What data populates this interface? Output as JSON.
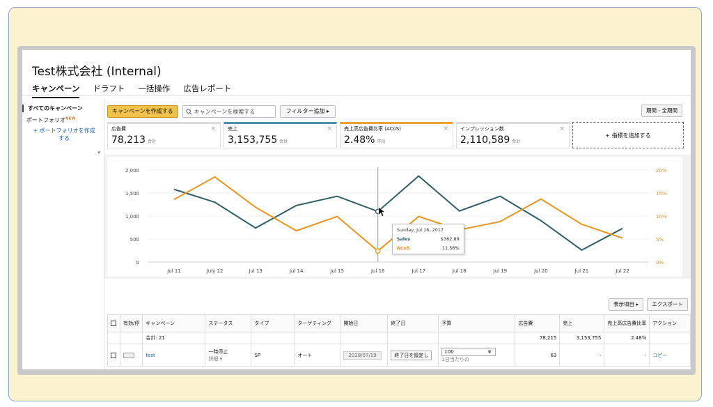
{
  "company": "Test株式会社 (Internal)",
  "tabs": [
    "キャンペーン",
    "ドラフト",
    "一括操作",
    "広告レポート"
  ],
  "sidebar": {
    "all_campaigns": "すべてのキャンペーン",
    "portfolio": "ポートフォリオ",
    "portfolio_badge": "NEW",
    "create_portfolio": "+ ポートフォリオを作成する"
  },
  "toolbar": {
    "create_campaign": "キャンペーンを作成する",
    "search_placeholder": "キャンペーンを検索する",
    "add_filter": "フィルター追加",
    "period": "期間 - 全期間"
  },
  "metrics": [
    {
      "label": "広告費",
      "value": "78,213",
      "suffix": "合計"
    },
    {
      "label": "売上",
      "value": "3,153,755",
      "suffix": "合計"
    },
    {
      "label": "売上高広告費比率 (ACoS)",
      "value": "2.48%",
      "suffix": "平均"
    },
    {
      "label": "インプレッション数",
      "value": "2,110,589",
      "suffix": "合計"
    }
  ],
  "add_metric": "+ 指標を追加する",
  "chart_data": {
    "type": "line",
    "categories": [
      "Jul 11",
      "July 12",
      "Jul 13",
      "Jul 14",
      "Jul 15",
      "Jul 16",
      "Jul 17",
      "Jul 18",
      "Jul 19",
      "Jul 20",
      "Jul 21",
      "Jul 22"
    ],
    "series": [
      {
        "name": "Sales",
        "axis": "left",
        "color": "#2e5e63",
        "values": [
          1580,
          1300,
          740,
          1230,
          1430,
          1100,
          1870,
          1110,
          1430,
          900,
          260,
          730
        ]
      },
      {
        "name": "ACoS",
        "axis": "right",
        "color": "#e69422",
        "values": [
          13.6,
          18.5,
          11.9,
          6.8,
          9.9,
          2.4,
          9.9,
          7.0,
          8.8,
          13.7,
          8.2,
          5.2
        ]
      }
    ],
    "yleft_ticks": [
      "2,000",
      "1,500",
      "1,000",
      "500",
      "0"
    ],
    "yleft_lim": [
      0,
      2000
    ],
    "yright_ticks": [
      "20%",
      "15%",
      "10%",
      "5%",
      "0%"
    ],
    "yright_lim": [
      0,
      20
    ],
    "grid": true,
    "hover_index": 5,
    "tooltip": {
      "date": "Sunday, Jul 16, 2017",
      "rows": [
        {
          "key": "Sales",
          "value": "$362.89"
        },
        {
          "key": "ACoS",
          "value": "11.56%"
        }
      ]
    }
  },
  "table_buttons": {
    "columns": "表示項目",
    "export": "エクスポート"
  },
  "table": {
    "headers": [
      "有効/停",
      "キャンペーン",
      "ステータス",
      "タイプ",
      "ターゲティング",
      "開始日",
      "終了日",
      "予算",
      "広告費",
      "売上",
      "売上高広告費比率",
      "アクション"
    ],
    "total": {
      "label": "合計: 21",
      "spend": "78,215",
      "sales": "3,153,755",
      "acos": "2.48%"
    },
    "rows": [
      {
        "campaign": "test",
        "status": "一時停止",
        "status_detail": "詳細",
        "type": "SP",
        "targeting": "オート",
        "start": "2018/07/19",
        "end": "終了日を設定し",
        "budget": "100",
        "currency": "¥",
        "budget_note": "1日当たりの",
        "spend": "63",
        "sales": "-",
        "acos": "-",
        "action": "コピー"
      }
    ]
  }
}
